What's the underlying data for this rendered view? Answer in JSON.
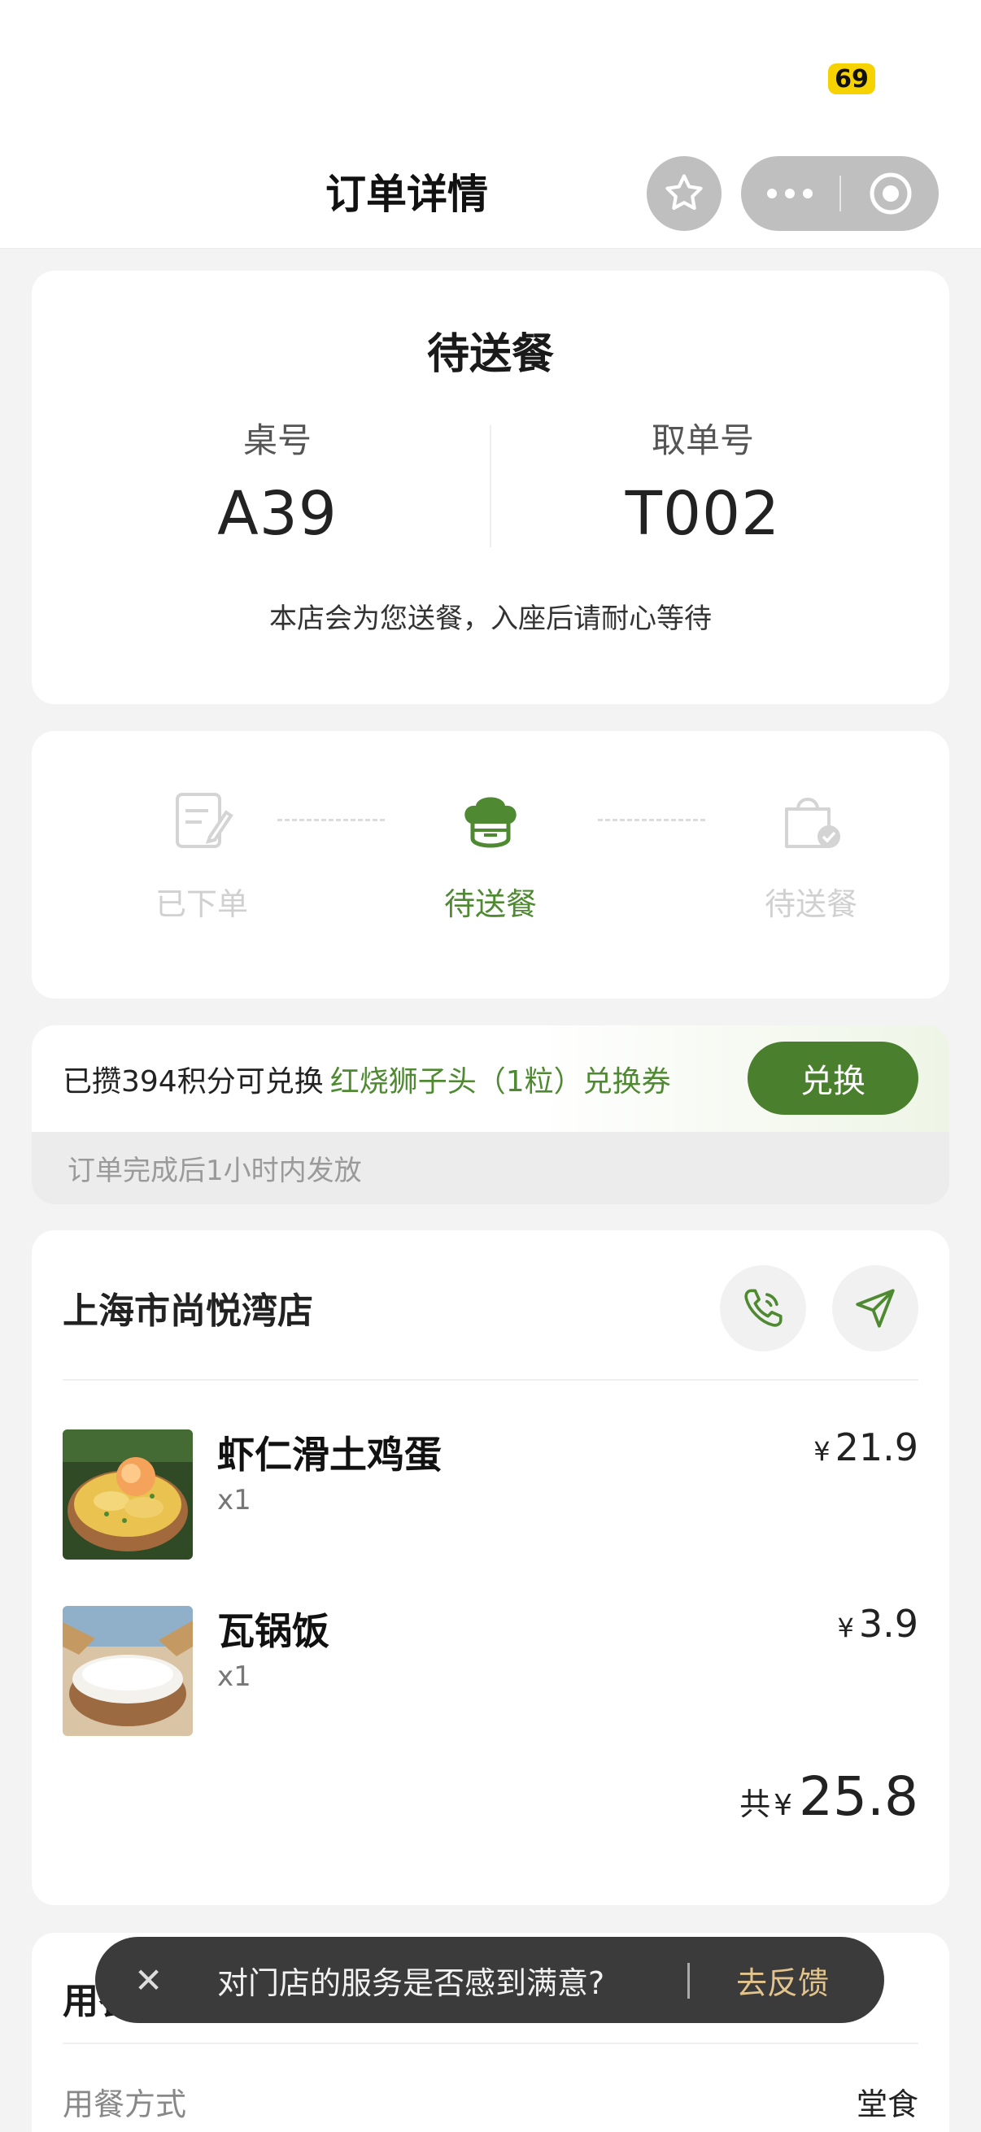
{
  "statusbar": {
    "battery": "69"
  },
  "navbar": {
    "title": "订单详情"
  },
  "order_status": {
    "title": "待送餐",
    "table_label": "桌号",
    "table_value": "A39",
    "pickup_label": "取单号",
    "pickup_value": "T002",
    "note": "本店会为您送餐，入座后请耐心等待"
  },
  "progress": {
    "steps": [
      {
        "label": "已下单",
        "icon": "order-placed-icon",
        "active": false
      },
      {
        "label": "待送餐",
        "icon": "chef-hat-icon",
        "active": true
      },
      {
        "label": "待送餐",
        "icon": "bag-check-icon",
        "active": false
      }
    ]
  },
  "points": {
    "prefix": "已攒394积分可兑换",
    "reward": "红烧狮子头（1粒）兑换券",
    "button": "兑换",
    "footnote": "订单完成后1小时内发放"
  },
  "store": {
    "name": "上海市尚悦湾店",
    "items": [
      {
        "name": "虾仁滑土鸡蛋",
        "qty": "x1",
        "currency": "¥",
        "price": "21.9"
      },
      {
        "name": "瓦锅饭",
        "qty": "x1",
        "currency": "¥",
        "price": "3.9"
      }
    ],
    "total_prefix": "共",
    "total_currency": "¥",
    "total": "25.8"
  },
  "dining": {
    "title": "用餐信息",
    "method_label": "用餐方式",
    "method_value": "堂食"
  },
  "toast": {
    "close": "✕",
    "text": "对门店的服务是否感到满意?",
    "action": "去反馈"
  },
  "colors": {
    "accent": "#4a7f2e",
    "accent_text": "#4f8a32",
    "toast_action": "#e3c48c"
  }
}
